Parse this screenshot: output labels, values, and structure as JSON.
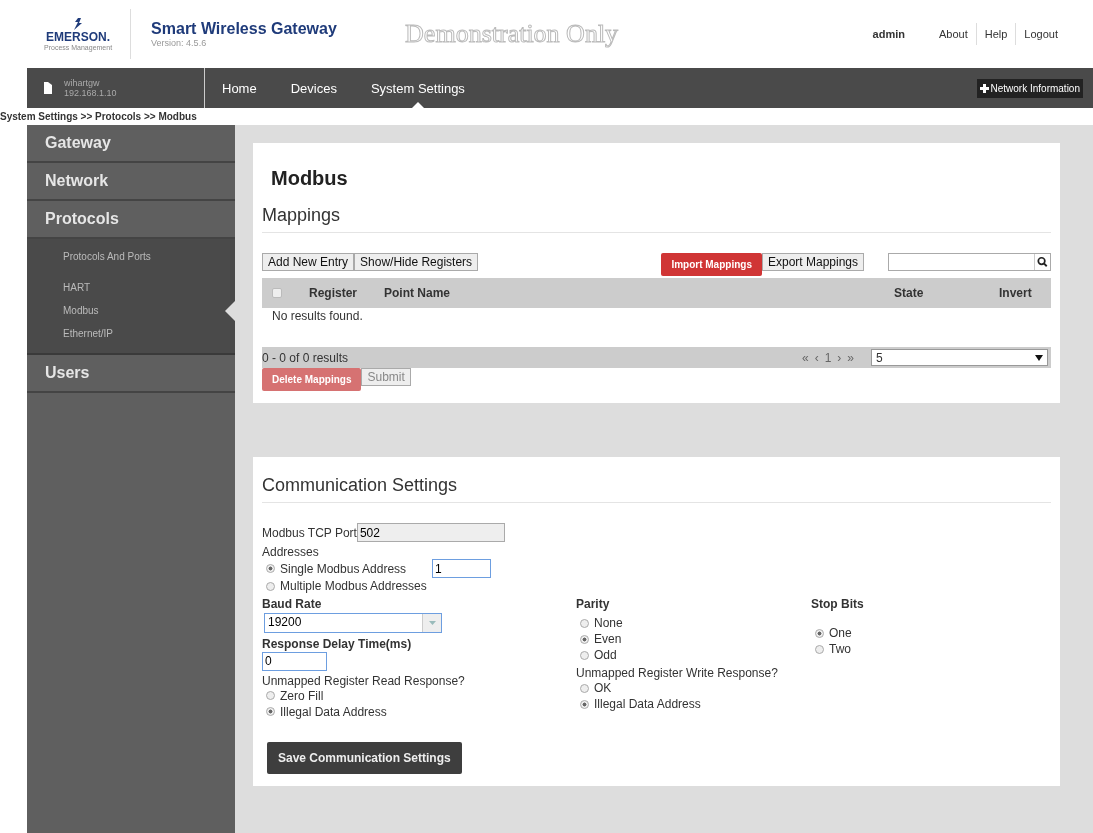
{
  "header": {
    "brand": "EMERSON.",
    "brand_sub": "Process Management",
    "title": "Smart Wireless Gateway",
    "version": "Version: 4.5.6",
    "demo": "Demonstration Only",
    "user": "admin",
    "links": [
      "About",
      "Help",
      "Logout"
    ]
  },
  "navbar": {
    "host": "wihartgw",
    "ip": "192.168.1.10",
    "items": [
      {
        "label": "Home",
        "selected": false
      },
      {
        "label": "Devices",
        "selected": false
      },
      {
        "label": "System Settings",
        "selected": true
      }
    ],
    "network_info": "Network Information"
  },
  "breadcrumb": "System Settings >> Protocols >> Modbus",
  "sidebar": {
    "items": [
      {
        "label": "Gateway"
      },
      {
        "label": "Network"
      },
      {
        "label": "Protocols",
        "children": [
          {
            "label": "Protocols And Ports",
            "selected": false
          },
          {
            "label": "HART",
            "selected": false
          },
          {
            "label": "Modbus",
            "selected": true
          },
          {
            "label": "Ethernet/IP",
            "selected": false
          }
        ]
      },
      {
        "label": "Users"
      }
    ]
  },
  "mappings": {
    "page_title": "Modbus",
    "title": "Mappings",
    "left_buttons": [
      "Add New Entry",
      "Show/Hide Registers"
    ],
    "import": "Import Mappings",
    "export": "Export Mappings",
    "select_all_checked": false,
    "columns": [
      "Register",
      "Point Name",
      "State",
      "Invert"
    ],
    "empty": "No results found.",
    "summary": "0 - 0 of 0 results",
    "pager": [
      "«",
      "‹",
      "1",
      "›",
      "»"
    ],
    "page_size": "5",
    "delete": "Delete Mappings",
    "submit": "Submit"
  },
  "comm": {
    "title": "Communication Settings",
    "port_label": "Modbus TCP Port",
    "port": "502",
    "addresses_label": "Addresses",
    "addresses": [
      {
        "label": "Single Modbus Address",
        "selected": true
      },
      {
        "label": "Multiple Modbus Addresses",
        "selected": false
      }
    ],
    "single_address": "1",
    "baud_label": "Baud Rate",
    "baud": "19200",
    "delay_label": "Response Delay Time(ms)",
    "delay": "0",
    "read_label": "Unmapped Register Read Response?",
    "read": [
      {
        "label": "Zero Fill",
        "selected": false
      },
      {
        "label": "Illegal Data Address",
        "selected": true
      }
    ],
    "parity_label": "Parity",
    "parity": [
      {
        "label": "None",
        "selected": false
      },
      {
        "label": "Even",
        "selected": true
      },
      {
        "label": "Odd",
        "selected": false
      }
    ],
    "write_label": "Unmapped Register Write Response?",
    "write": [
      {
        "label": "OK",
        "selected": false
      },
      {
        "label": "Illegal Data Address",
        "selected": true
      }
    ],
    "stop_label": "Stop Bits",
    "stop": [
      {
        "label": "One",
        "selected": true
      },
      {
        "label": "Two",
        "selected": false
      }
    ],
    "save": "Save Communication Settings"
  }
}
